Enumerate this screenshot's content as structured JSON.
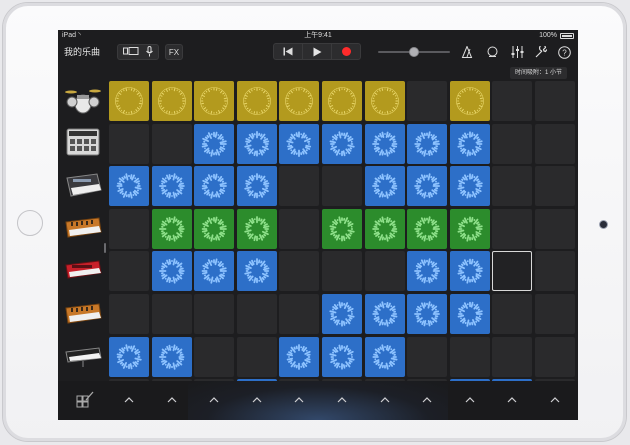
{
  "statusbar": {
    "carrier": "iPad",
    "time": "上午9:41",
    "battery": "100%"
  },
  "toolbar": {
    "my_songs": "我的乐曲",
    "fx_label": "FX",
    "volume_level": 0.5,
    "icons": [
      "browser-toggle-icon",
      "microphone-icon",
      "rewind-icon",
      "play-icon",
      "record-icon",
      "metronome-icon",
      "loop-icon",
      "mixer-icon",
      "settings-wrench-icon",
      "help-icon"
    ]
  },
  "time_snap": "时间吸附：1 小节",
  "tracks": [
    {
      "name": "drums",
      "icon": "drum-kit-icon"
    },
    {
      "name": "beat-sequencer",
      "icon": "beat-machine-icon"
    },
    {
      "name": "synth-1",
      "icon": "synth-keyboard-icon"
    },
    {
      "name": "synth-2",
      "icon": "orange-synth-icon"
    },
    {
      "name": "synth-3",
      "icon": "red-keyboard-icon"
    },
    {
      "name": "synth-4",
      "icon": "orange-synth-icon"
    },
    {
      "name": "piano",
      "icon": "piano-keyboard-icon"
    }
  ],
  "colors": {
    "yellow": "#b39a1e",
    "blue": "#2d6fc8",
    "green": "#2c8c2c",
    "empty": "#2a2a2c"
  },
  "grid": {
    "columns": 11,
    "rows": [
      [
        "yellow",
        "yellow",
        "yellow",
        "yellow",
        "yellow",
        "yellow",
        "yellow",
        "empty",
        "yellow",
        "empty",
        "empty"
      ],
      [
        "empty",
        "empty",
        "blue",
        "blue",
        "blue",
        "blue",
        "blue",
        "blue",
        "blue",
        "empty",
        "empty"
      ],
      [
        "blue",
        "blue",
        "blue",
        "blue",
        "empty",
        "empty",
        "blue",
        "blue",
        "blue",
        "empty",
        "empty"
      ],
      [
        "empty",
        "green",
        "green",
        "green",
        "empty",
        "green",
        "green",
        "green",
        "green",
        "empty",
        "empty"
      ],
      [
        "empty",
        "blue",
        "blue",
        "blue",
        "empty",
        "empty",
        "empty",
        "blue",
        "blue",
        "selected",
        "empty"
      ],
      [
        "empty",
        "empty",
        "empty",
        "empty",
        "empty",
        "blue",
        "blue",
        "blue",
        "blue",
        "empty",
        "empty"
      ],
      [
        "blue",
        "blue",
        "empty",
        "empty",
        "blue",
        "blue",
        "blue",
        "empty",
        "empty",
        "empty",
        "empty"
      ],
      [
        "empty",
        "empty",
        "empty",
        "blue",
        "empty",
        "empty",
        "empty",
        "empty",
        "blue",
        "blue",
        "empty"
      ]
    ]
  },
  "bottom_bar": {
    "edit_icon": "edit-cells-icon",
    "trigger_count": 11
  }
}
